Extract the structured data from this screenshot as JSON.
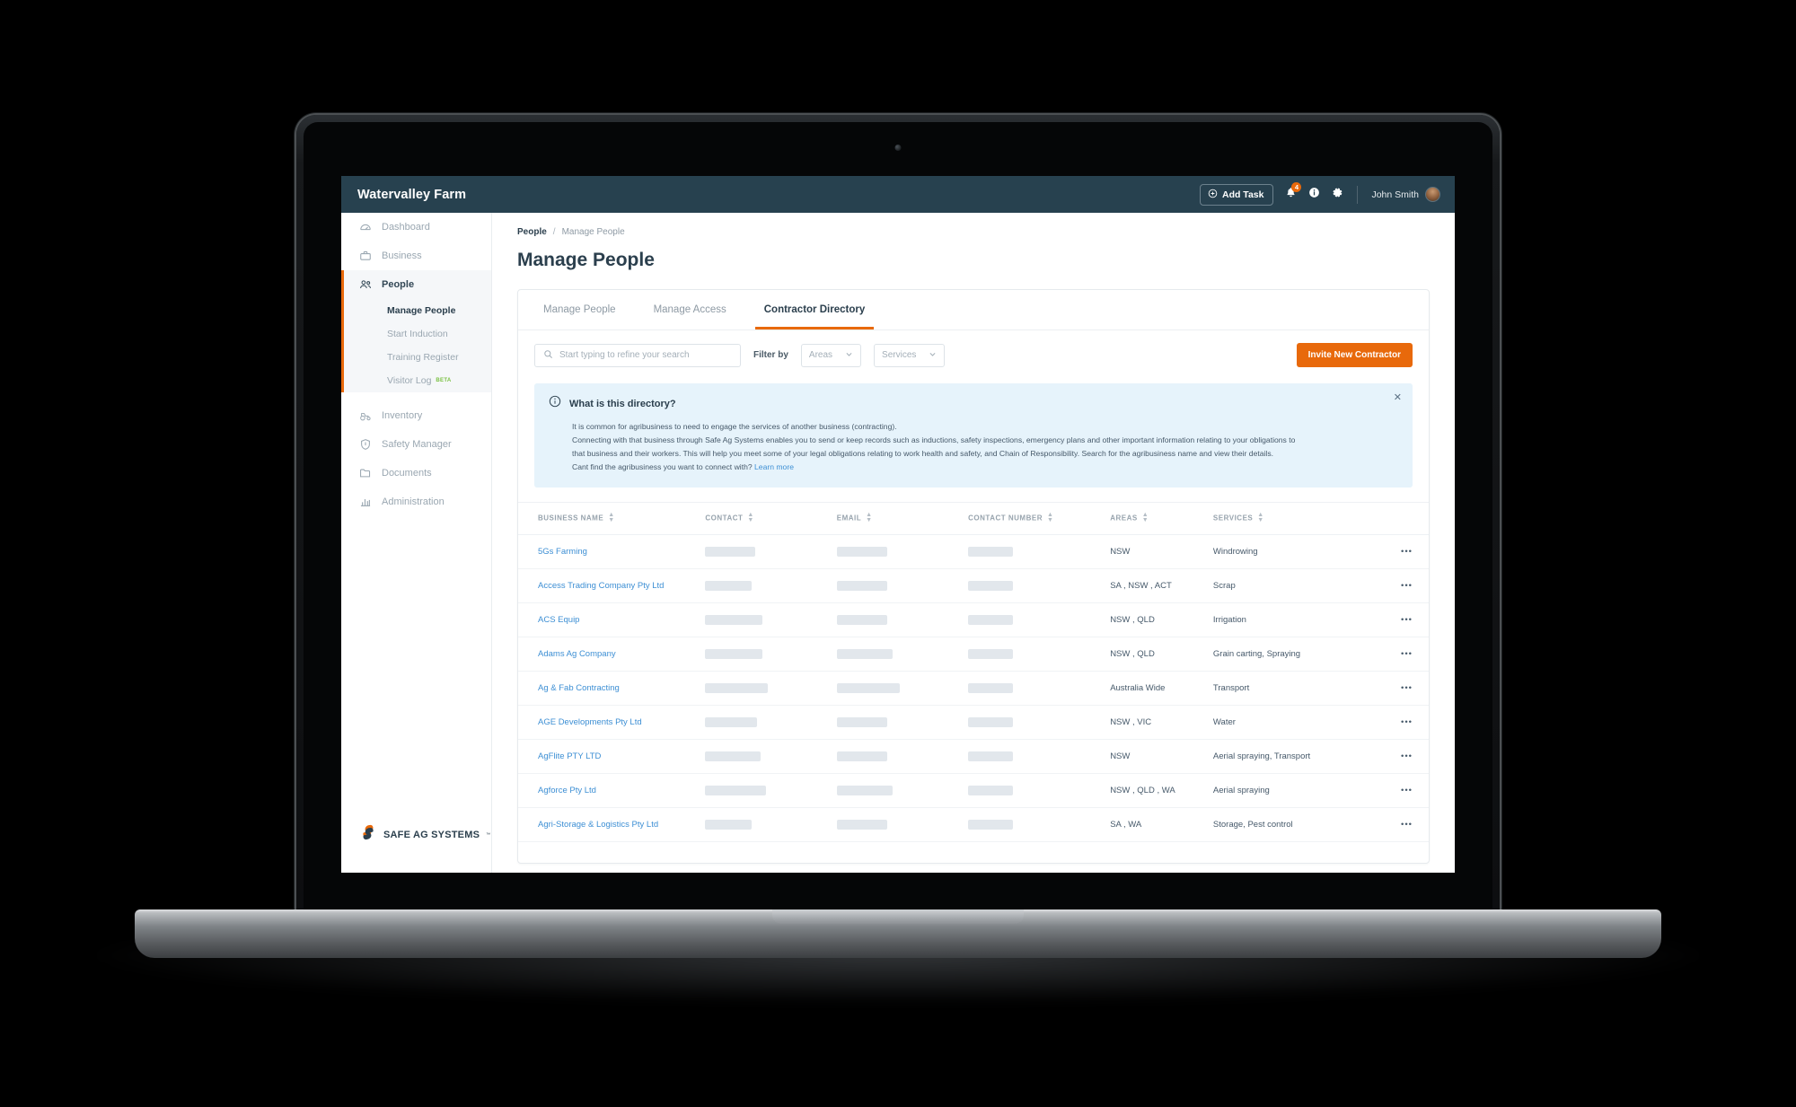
{
  "topbar": {
    "farm_title": "Watervalley Farm",
    "add_task_label": "Add Task",
    "notification_badge": "4",
    "user_name": "John Smith"
  },
  "sidebar": {
    "items": [
      {
        "label": "Dashboard",
        "icon": "speedometer-icon"
      },
      {
        "label": "Business",
        "icon": "briefcase-icon"
      },
      {
        "label": "People",
        "icon": "people-icon"
      }
    ],
    "people_subitems": [
      {
        "label": "Manage People",
        "active": true
      },
      {
        "label": "Start Induction",
        "active": false
      },
      {
        "label": "Training Register",
        "active": false
      },
      {
        "label": "Visitor Log",
        "badge": "BETA",
        "active": false
      }
    ],
    "items_lower": [
      {
        "label": "Inventory",
        "icon": "tractor-icon"
      },
      {
        "label": "Safety Manager",
        "icon": "shield-icon"
      },
      {
        "label": "Documents",
        "icon": "folder-icon"
      },
      {
        "label": "Administration",
        "icon": "bar-chart-icon"
      }
    ],
    "logo_text": "SAFE AG SYSTEMS",
    "logo_tm": "™"
  },
  "breadcrumb": {
    "parent": "People",
    "separator": "/",
    "current": "Manage People"
  },
  "page_title": "Manage People",
  "tabs": [
    {
      "label": "Manage People",
      "active": false
    },
    {
      "label": "Manage Access",
      "active": false
    },
    {
      "label": "Contractor Directory",
      "active": true
    }
  ],
  "toolbar": {
    "search_placeholder": "Start typing to refine your search",
    "search_value": "",
    "filter_label": "Filter by",
    "filter_areas": "Areas",
    "filter_services": "Services",
    "invite_label": "Invite New Contractor"
  },
  "info_banner": {
    "title": "What is this directory?",
    "line1": "It is common for agribusiness to need to engage the services of another business (contracting).",
    "line2": "Connecting with that business through Safe Ag Systems enables you to send or keep records such as inductions, safety inspections, emergency plans and other important information relating to your obligations to",
    "line3": "that business and their workers. This will help you meet some of your legal obligations relating to work health and safety, and Chain of Responsibility. Search for the agribusiness name and view their details.",
    "line4_prefix": "Cant find the agribusiness you want to connect with? ",
    "line4_link": "Learn more",
    "close_label": "✕"
  },
  "table": {
    "columns": [
      "BUSINESS NAME",
      "CONTACT",
      "EMAIL",
      "CONTACT NUMBER",
      "AREAS",
      "SERVICES"
    ],
    "rows": [
      {
        "business_name": "5Gs Farming",
        "contact": "",
        "email": "",
        "contact_number": "",
        "areas": "NSW",
        "services": "Windrowing",
        "menu": "•••"
      },
      {
        "business_name": "Access Trading Company Pty Ltd",
        "contact": "",
        "email": "",
        "contact_number": "",
        "areas": "SA , NSW , ACT",
        "services": "Scrap",
        "menu": "•••"
      },
      {
        "business_name": "ACS Equip",
        "contact": "",
        "email": "",
        "contact_number": "",
        "areas": "NSW , QLD",
        "services": "Irrigation",
        "menu": "•••"
      },
      {
        "business_name": "Adams Ag Company",
        "contact": "",
        "email": "",
        "contact_number": "",
        "areas": "NSW , QLD",
        "services": "Grain carting, Spraying",
        "menu": "•••"
      },
      {
        "business_name": "Ag & Fab Contracting",
        "contact": "",
        "email": "",
        "contact_number": "",
        "areas": "Australia Wide",
        "services": "Transport",
        "menu": "•••"
      },
      {
        "business_name": "AGE Developments Pty Ltd",
        "contact": "",
        "email": "",
        "contact_number": "",
        "areas": "NSW , VIC",
        "services": "Water",
        "menu": "•••"
      },
      {
        "business_name": "AgFlite PTY LTD",
        "contact": "",
        "email": "",
        "contact_number": "",
        "areas": "NSW",
        "services": "Aerial spraying, Transport",
        "menu": "•••"
      },
      {
        "business_name": "Agforce Pty Ltd",
        "contact": "",
        "email": "",
        "contact_number": "",
        "areas": "NSW , QLD , WA",
        "services": "Aerial spraying",
        "menu": "•••"
      },
      {
        "business_name": "Agri-Storage & Logistics Pty Ltd",
        "contact": "",
        "email": "",
        "contact_number": "",
        "areas": "SA , WA",
        "services": "Storage, Pest control",
        "menu": "•••"
      }
    ],
    "redact_widths": [
      [
        "56px",
        "56px",
        "50px"
      ],
      [
        "52px",
        "56px",
        "50px"
      ],
      [
        "64px",
        "56px",
        "50px"
      ],
      [
        "64px",
        "62px",
        "50px"
      ],
      [
        "70px",
        "70px",
        "50px"
      ],
      [
        "58px",
        "56px",
        "50px"
      ],
      [
        "62px",
        "56px",
        "50px"
      ],
      [
        "68px",
        "62px",
        "50px"
      ],
      [
        "52px",
        "56px",
        "50px"
      ]
    ]
  },
  "fabs": [
    {
      "label": "?",
      "name": "help-fab"
    },
    {
      "label": "✎",
      "name": "feedback-fab"
    }
  ],
  "colors": {
    "accent": "#e8690b",
    "navy": "#27414f",
    "link": "#3d8fd4",
    "info_bg": "#e6f3fb",
    "beta": "#7ac143"
  }
}
